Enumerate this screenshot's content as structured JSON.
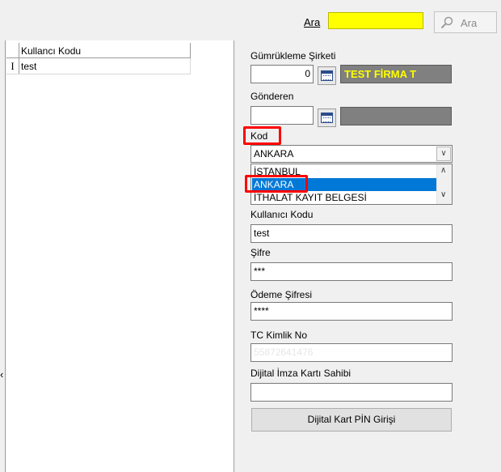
{
  "toolbar": {
    "search_label": "Ara",
    "search_value": "",
    "search_button_label": "Ara",
    "search_highlight_color": "#ffff00"
  },
  "grid": {
    "column_header": "Kullancı Kodu",
    "rows": [
      {
        "indicator": "I",
        "value": "test"
      }
    ]
  },
  "form": {
    "customs_company": {
      "label": "Gümrükleme Şirketi",
      "code_value": "0",
      "name_value": "TEST FİRMA T"
    },
    "sender": {
      "label": "Gönderen",
      "code_value": "",
      "name_value": ""
    },
    "kod": {
      "label": "Kod",
      "selected_value": "ANKARA",
      "options": [
        "İSTANBUL",
        "ANKARA",
        "İTHALAT KAYIT BELGESİ"
      ],
      "highlighted_option": "ANKARA"
    },
    "user_code": {
      "label": "Kullanıcı Kodu",
      "value": "test"
    },
    "password": {
      "label": "Şifre",
      "value": "***"
    },
    "payment_password": {
      "label": "Ödeme Şifresi",
      "value": "****"
    },
    "tc_identity": {
      "label": "TC Kimlik No",
      "value": "55872641476"
    },
    "signature_owner": {
      "label": "Dijital İmza Kartı Sahibi",
      "value": ""
    },
    "pin_button_label": "Dijital Kart PİN Girişi"
  }
}
